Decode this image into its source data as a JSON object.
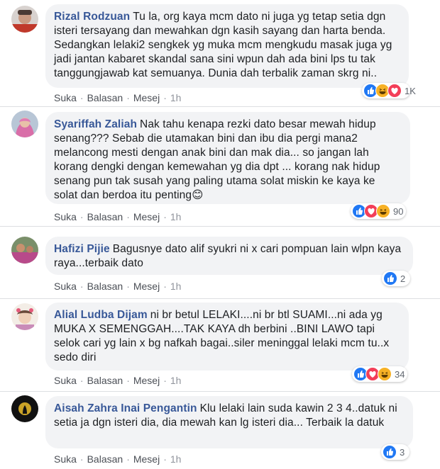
{
  "comments": [
    {
      "author": "Rizal Rodzuan",
      "text": "Tu la, org kaya mcm dato ni juga yg tetap setia dgn isteri tersayang dan mewahkan dgn kasih sayang dan harta benda. Sedangkan lelaki2 sengkek yg muka mcm mengkudu masak juga yg jadi jantan kabaret skandal sana sini wpun dah ada bini lps tu tak tanggungjawab kat semuanya. Dunia dah terbalik zaman skrg ni..",
      "reaction_icons": [
        "like-icon",
        "haha-icon",
        "love-icon"
      ],
      "reaction_count": "1K"
    },
    {
      "author": "Syariffah Zaliah",
      "text": "Nak tahu kenapa rezki dato besar mewah hidup senang??? Sebab die utamakan bini dan ibu dia pergi mana2 melancong mesti dengan anak bini dan mak dia... so jangan lah korang dengki dengan kemewahan yg dia dpt ... korang nak hidup senang pun tak susah yang paling utama solat miskin ke kaya ke solat dan berdoa itu penting😊",
      "reaction_icons": [
        "like-icon",
        "love-icon",
        "haha-icon"
      ],
      "reaction_count": "90"
    },
    {
      "author": "Hafizi Pijie",
      "text": "Bagusnye dato alif syukri ni x cari pompuan lain wlpn kaya raya...terbaik dato",
      "reaction_icons": [
        "like-icon"
      ],
      "reaction_count": "2"
    },
    {
      "author": "Alial Ludba Dijam",
      "text": "ni br betul LELAKI....ni br btl SUAMI...ni ada yg MUKA X SEMENGGAH....TAK KAYA dh berbini ..BINI LAWO tapi selok cari yg lain x bg nafkah bagai..siler meninggal lelaki mcm tu..x sedo diri",
      "reaction_icons": [
        "like-icon",
        "love-icon",
        "haha-icon"
      ],
      "reaction_count": "34"
    },
    {
      "author": "Aisah Zahra Inai Pengantin",
      "text": "Klu lelaki lain suda kawin 2 3 4..datuk ni setia ja dgn isteri dia, dia mewah kan lg isteri dia... Terbaik la datuk",
      "reaction_icons": [
        "like-icon"
      ],
      "reaction_count": "3"
    }
  ],
  "actions": {
    "like": "Suka",
    "reply": "Balasan",
    "message": "Mesej",
    "time": "1h",
    "sep": "·"
  },
  "colors": {
    "author": "#385898",
    "bubble": "#f2f3f5",
    "like": "#2078f4",
    "love": "#f33e58",
    "haha": "#f7b125"
  }
}
